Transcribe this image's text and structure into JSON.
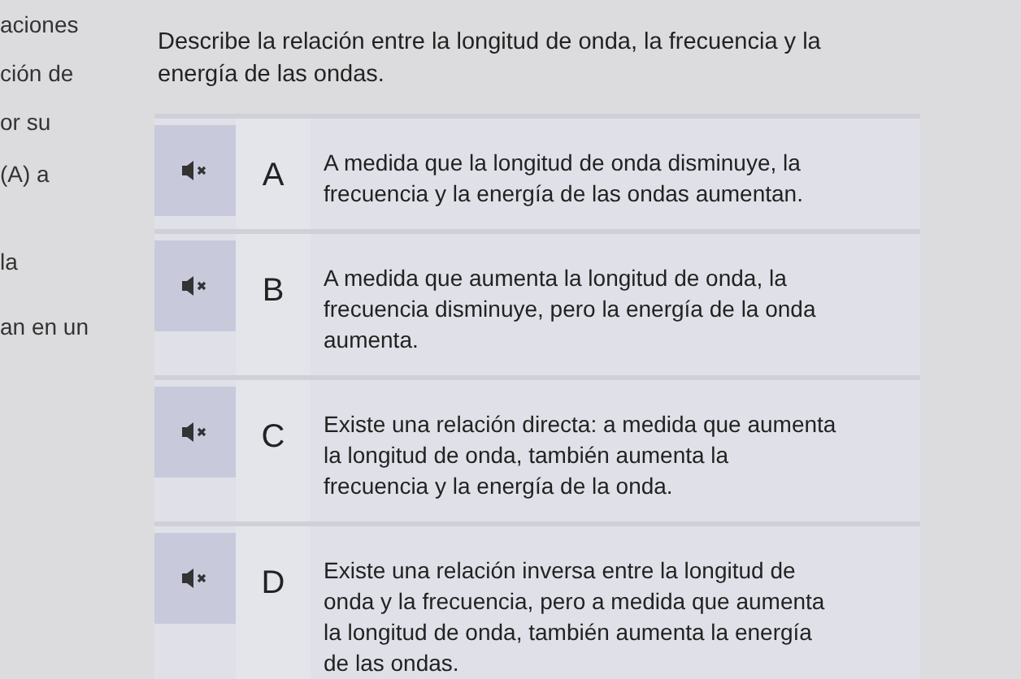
{
  "background_text": [
    "aciones",
    "ción de",
    "or su",
    "(A) a",
    "la",
    "an en un"
  ],
  "question": "Describe la relación entre la longitud de onda, la frecuencia y la energía de las ondas.",
  "options": [
    {
      "letter": "A",
      "text": "A medida que la longitud de onda disminuye, la frecuencia y la energía de las ondas aumentan.",
      "selected": false
    },
    {
      "letter": "B",
      "text": "A medida que aumenta la longitud de onda, la frecuencia disminuye, pero la energía de la onda aumenta.",
      "selected": false
    },
    {
      "letter": "C",
      "text": "Existe una relación directa: a medida que aumenta la longitud de onda, también aumenta la frecuencia y la energía de la onda.",
      "selected": false
    },
    {
      "letter": "D",
      "text": "Existe una relación inversa entre la longitud de onda y la frecuencia, pero a medida que aumenta la longitud de onda, también aumenta la energía de las ondas.",
      "selected": false
    }
  ]
}
